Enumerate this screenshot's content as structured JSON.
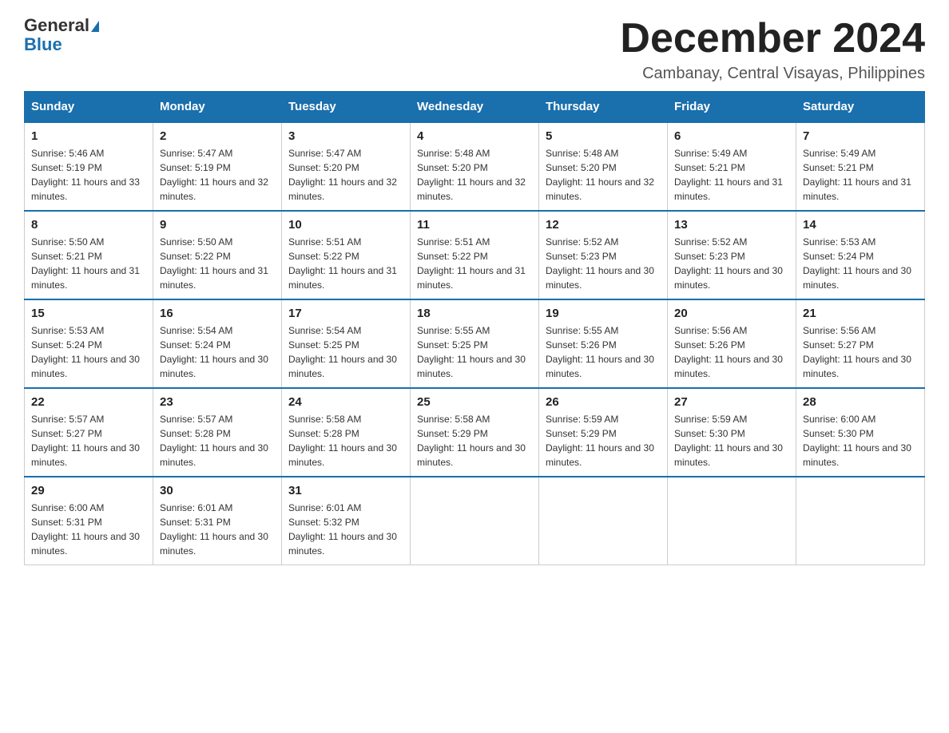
{
  "logo": {
    "general": "General",
    "blue": "Blue"
  },
  "title": "December 2024",
  "location": "Cambanay, Central Visayas, Philippines",
  "days_of_week": [
    "Sunday",
    "Monday",
    "Tuesday",
    "Wednesday",
    "Thursday",
    "Friday",
    "Saturday"
  ],
  "weeks": [
    [
      {
        "day": 1,
        "sunrise": "5:46 AM",
        "sunset": "5:19 PM",
        "daylight": "11 hours and 33 minutes."
      },
      {
        "day": 2,
        "sunrise": "5:47 AM",
        "sunset": "5:19 PM",
        "daylight": "11 hours and 32 minutes."
      },
      {
        "day": 3,
        "sunrise": "5:47 AM",
        "sunset": "5:20 PM",
        "daylight": "11 hours and 32 minutes."
      },
      {
        "day": 4,
        "sunrise": "5:48 AM",
        "sunset": "5:20 PM",
        "daylight": "11 hours and 32 minutes."
      },
      {
        "day": 5,
        "sunrise": "5:48 AM",
        "sunset": "5:20 PM",
        "daylight": "11 hours and 32 minutes."
      },
      {
        "day": 6,
        "sunrise": "5:49 AM",
        "sunset": "5:21 PM",
        "daylight": "11 hours and 31 minutes."
      },
      {
        "day": 7,
        "sunrise": "5:49 AM",
        "sunset": "5:21 PM",
        "daylight": "11 hours and 31 minutes."
      }
    ],
    [
      {
        "day": 8,
        "sunrise": "5:50 AM",
        "sunset": "5:21 PM",
        "daylight": "11 hours and 31 minutes."
      },
      {
        "day": 9,
        "sunrise": "5:50 AM",
        "sunset": "5:22 PM",
        "daylight": "11 hours and 31 minutes."
      },
      {
        "day": 10,
        "sunrise": "5:51 AM",
        "sunset": "5:22 PM",
        "daylight": "11 hours and 31 minutes."
      },
      {
        "day": 11,
        "sunrise": "5:51 AM",
        "sunset": "5:22 PM",
        "daylight": "11 hours and 31 minutes."
      },
      {
        "day": 12,
        "sunrise": "5:52 AM",
        "sunset": "5:23 PM",
        "daylight": "11 hours and 30 minutes."
      },
      {
        "day": 13,
        "sunrise": "5:52 AM",
        "sunset": "5:23 PM",
        "daylight": "11 hours and 30 minutes."
      },
      {
        "day": 14,
        "sunrise": "5:53 AM",
        "sunset": "5:24 PM",
        "daylight": "11 hours and 30 minutes."
      }
    ],
    [
      {
        "day": 15,
        "sunrise": "5:53 AM",
        "sunset": "5:24 PM",
        "daylight": "11 hours and 30 minutes."
      },
      {
        "day": 16,
        "sunrise": "5:54 AM",
        "sunset": "5:24 PM",
        "daylight": "11 hours and 30 minutes."
      },
      {
        "day": 17,
        "sunrise": "5:54 AM",
        "sunset": "5:25 PM",
        "daylight": "11 hours and 30 minutes."
      },
      {
        "day": 18,
        "sunrise": "5:55 AM",
        "sunset": "5:25 PM",
        "daylight": "11 hours and 30 minutes."
      },
      {
        "day": 19,
        "sunrise": "5:55 AM",
        "sunset": "5:26 PM",
        "daylight": "11 hours and 30 minutes."
      },
      {
        "day": 20,
        "sunrise": "5:56 AM",
        "sunset": "5:26 PM",
        "daylight": "11 hours and 30 minutes."
      },
      {
        "day": 21,
        "sunrise": "5:56 AM",
        "sunset": "5:27 PM",
        "daylight": "11 hours and 30 minutes."
      }
    ],
    [
      {
        "day": 22,
        "sunrise": "5:57 AM",
        "sunset": "5:27 PM",
        "daylight": "11 hours and 30 minutes."
      },
      {
        "day": 23,
        "sunrise": "5:57 AM",
        "sunset": "5:28 PM",
        "daylight": "11 hours and 30 minutes."
      },
      {
        "day": 24,
        "sunrise": "5:58 AM",
        "sunset": "5:28 PM",
        "daylight": "11 hours and 30 minutes."
      },
      {
        "day": 25,
        "sunrise": "5:58 AM",
        "sunset": "5:29 PM",
        "daylight": "11 hours and 30 minutes."
      },
      {
        "day": 26,
        "sunrise": "5:59 AM",
        "sunset": "5:29 PM",
        "daylight": "11 hours and 30 minutes."
      },
      {
        "day": 27,
        "sunrise": "5:59 AM",
        "sunset": "5:30 PM",
        "daylight": "11 hours and 30 minutes."
      },
      {
        "day": 28,
        "sunrise": "6:00 AM",
        "sunset": "5:30 PM",
        "daylight": "11 hours and 30 minutes."
      }
    ],
    [
      {
        "day": 29,
        "sunrise": "6:00 AM",
        "sunset": "5:31 PM",
        "daylight": "11 hours and 30 minutes."
      },
      {
        "day": 30,
        "sunrise": "6:01 AM",
        "sunset": "5:31 PM",
        "daylight": "11 hours and 30 minutes."
      },
      {
        "day": 31,
        "sunrise": "6:01 AM",
        "sunset": "5:32 PM",
        "daylight": "11 hours and 30 minutes."
      },
      null,
      null,
      null,
      null
    ]
  ]
}
